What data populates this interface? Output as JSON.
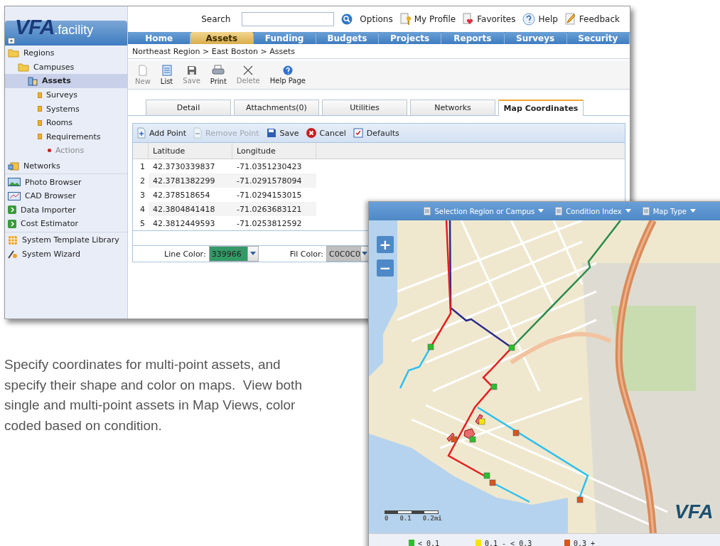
{
  "app_window": {
    "logo": {
      "brand": "VFA",
      "suffix": ".facility"
    },
    "search": {
      "label": "Search"
    },
    "top_links": [
      "Options",
      "My Profile",
      "Favorites",
      "Help",
      "Feedback"
    ],
    "nav_tabs": [
      {
        "label": "Home",
        "selected": false
      },
      {
        "label": "Assets",
        "selected": true
      },
      {
        "label": "Funding",
        "selected": false
      },
      {
        "label": "Budgets",
        "selected": false
      },
      {
        "label": "Projects",
        "selected": false
      },
      {
        "label": "Reports",
        "selected": false
      },
      {
        "label": "Surveys",
        "selected": false
      },
      {
        "label": "Security",
        "selected": false
      }
    ],
    "sidebar": {
      "tree": [
        {
          "label": "Regions",
          "kind": "folder",
          "selected": false,
          "children": [
            {
              "label": "Campuses",
              "kind": "folder",
              "selected": false,
              "children": [
                {
                  "label": "Assets",
                  "kind": "asset",
                  "selected": true,
                  "children": [
                    {
                      "label": "Surveys",
                      "kind": "leaf",
                      "selected": false
                    },
                    {
                      "label": "Systems",
                      "kind": "leaf",
                      "selected": false
                    },
                    {
                      "label": "Rooms",
                      "kind": "leaf",
                      "selected": false
                    },
                    {
                      "label": "Requirements",
                      "kind": "leaf",
                      "selected": false,
                      "children": [
                        {
                          "label": "Actions",
                          "kind": "action",
                          "selected": false,
                          "disabled": true
                        }
                      ]
                    }
                  ]
                }
              ]
            }
          ]
        }
      ],
      "groups": [
        [
          "Networks"
        ],
        [
          "Photo Browser",
          "CAD Browser",
          "Data Importer",
          "Cost Estimator"
        ],
        [
          "System Template Library",
          "System Wizard"
        ]
      ]
    },
    "breadcrumb": "Northeast Region > East Boston > Assets",
    "toolbar": [
      {
        "label": "New",
        "disabled": true
      },
      {
        "label": "List",
        "disabled": false
      },
      {
        "label": "Save",
        "disabled": true
      },
      {
        "label": "Print",
        "disabled": false
      },
      {
        "label": "Delete",
        "disabled": true
      },
      {
        "label": "Help Page",
        "disabled": false
      }
    ],
    "detail_tabs": [
      {
        "label": "Detail",
        "selected": false
      },
      {
        "label": "Attachments(0)",
        "selected": false
      },
      {
        "label": "Utilities",
        "selected": false
      },
      {
        "label": "Networks",
        "selected": false
      },
      {
        "label": "Map Coordinates",
        "selected": true
      }
    ],
    "grid": {
      "actions": [
        {
          "label": "Add Point",
          "disabled": false
        },
        {
          "label": "Remove Point",
          "disabled": true
        },
        {
          "label": "Save",
          "disabled": false
        },
        {
          "label": "Cancel",
          "disabled": false
        },
        {
          "label": "Defaults",
          "disabled": false
        }
      ],
      "columns": [
        "Latitude",
        "Longitude"
      ],
      "rows": [
        {
          "index": "1",
          "latitude": "42.3730339837",
          "longitude": "-71.0351230423"
        },
        {
          "index": "2",
          "latitude": "42.3781382299",
          "longitude": "-71.0291578094"
        },
        {
          "index": "3",
          "latitude": "42.378518654",
          "longitude": "-71.0294153015"
        },
        {
          "index": "4",
          "latitude": "42.3804841418",
          "longitude": "-71.0263683121"
        },
        {
          "index": "5",
          "latitude": "42.3812449593",
          "longitude": "-71.0253812592"
        }
      ],
      "line_color": {
        "label": "Line Color:",
        "value": "339966",
        "color": "#339966"
      },
      "fill_color": {
        "label": "Fil Color:",
        "value": "C0C0C0",
        "color": "#c0c0c0"
      }
    }
  },
  "caption": "Specify coordinates for multi-point assets, and specify their shape and color on maps.  View both single and multi-point assets in Map Views, color coded based on condition.",
  "map_window": {
    "menus": [
      "Selection Region or Campus",
      "Condition Index",
      "Map Type"
    ],
    "zoom_buttons": [
      "+",
      "−"
    ],
    "scale_labels": [
      "0",
      "0.1",
      "0.2mi"
    ],
    "logo": "VFA",
    "legend": [
      {
        "label": "< 0.1",
        "color": "#2dbd2d"
      },
      {
        "label": "0.1 - < 0.3",
        "color": "#f5e600"
      },
      {
        "label": "0.3 +",
        "color": "#d9541e"
      }
    ]
  }
}
